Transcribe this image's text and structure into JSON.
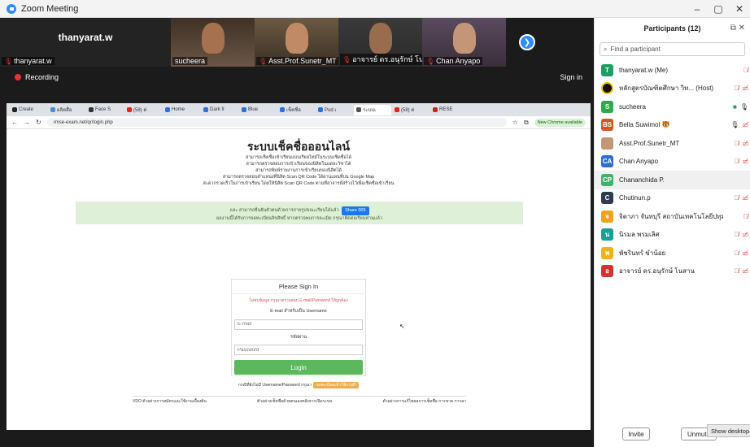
{
  "window": {
    "title": "Zoom Meeting",
    "controls": [
      "–",
      "▢",
      "✕"
    ]
  },
  "gallery": {
    "self_display_name": "thanyarat.w",
    "tiles": [
      {
        "label": "thanyarat.w",
        "muted": true
      },
      {
        "label": "sucheera",
        "muted": false
      },
      {
        "label": "Asst.Prof.Sunetr_MT",
        "muted": true
      },
      {
        "label": "อาจารย์ ดร.อนุรักษ์ โนสาน",
        "muted": true
      },
      {
        "label": "Chan Anyapo",
        "muted": true
      }
    ],
    "next_icon": "chevron-right-icon"
  },
  "status": {
    "recording": "Recording",
    "signin": "Sign in"
  },
  "browser": {
    "tabs": [
      "Create",
      "ผลิตสื่อ",
      "Face S",
      "(58) ต่",
      "Home",
      "Dark II",
      "Blue",
      "เช็คชื่อ",
      "Pod เ",
      "ระบบเ",
      "(58) ต่",
      "RESE"
    ],
    "url": "rmse-exam.net/qr/login.php",
    "new_chrome": "New Chrome available"
  },
  "page": {
    "title": "ระบบเช็คชื่อออนไลน์",
    "intro": [
      "สามารถเช็คชื่อเข้าเรียนแบบเรียลไทม์ในระบบเช็คชื่อได้",
      "สามารถตรวจสอบการเข้าเรียนของนิสิตในแต่ละวิชาได้",
      "สามารถพิมพ์รายงานการเข้าเรียนของนิสิตได้",
      "สามารถตรวจสอบตำแหน่งที่นิสิต Scan QR Code ได้ผ่านแผนที่บน Google Map",
      "สะดวกรวดเร็วในการเข้าเรียน โดยให้นิสิต Scan QR Code ตามที่อาจารย์สร้างไว้เพื่อเช็คชื่อเข้าเรียน"
    ],
    "notice_line1": "และ สามารถยืนยันตัวตนด้วยการถ่ายรูปขณะเรียนได้แล้ว",
    "notice_line2": "ผลงานนี้ได้รับการจดทะเบียนลิขสิทธิ์ หากตรวจพบการละเมิด กรุณาติดต่อเรียนท่านแล้ว",
    "share_label": "Share 005",
    "login": {
      "heading": "Please Sign In",
      "warning": "ไม่พบข้อมูล กรุณาตรวจสอบ E-mail/Password ให้ถูกต้อง",
      "email_label": "E-mail สำหรับเป็น Username",
      "email_placeholder": "E-mail",
      "password_label": "รหัสผ่าน",
      "password_placeholder": "Password",
      "button": "Login"
    },
    "forgot_text": "กรณีที่ยังไม่มี Username/Password กรุณา",
    "forgot_button": "ลงทะเบียนเข้าใช้งานที่",
    "footer_links": [
      "VDO ตัวอย่างการสมัครและใช้งานเบื้องต้น",
      "ตัวอย่างเช็คชื่อด้วยตนเองหลังจากเปิดระบบ",
      "ตัวอย่างการแก้ไขผลการเช็คชื่อ การขาด การลา"
    ]
  },
  "participants": {
    "header": "Participants (12)",
    "search_placeholder": "Find a participant",
    "list": [
      {
        "initial": "T",
        "color": "#1f9e63",
        "name": "thanyarat.w (Me)",
        "mic": "off",
        "cam": "none"
      },
      {
        "initial": "",
        "color": "#111111",
        "name": "หลักสูตรบัณฑิตศึกษา วิท... (Host)",
        "mic": "off",
        "cam": "off"
      },
      {
        "initial": "S",
        "color": "#2fa84f",
        "name": "sucheera",
        "mic": "on",
        "cam": "on"
      },
      {
        "initial": "BS",
        "color": "#d9541e",
        "name": "Bella Suwimol 🐯",
        "mic": "on",
        "cam": "off"
      },
      {
        "initial": "",
        "color": "#8a6a55",
        "name": "Asst.Prof.Sunetr_MT",
        "mic": "off",
        "cam": "off"
      },
      {
        "initial": "CA",
        "color": "#2d6fd8",
        "name": "Chan Anyapo",
        "mic": "off",
        "cam": "off"
      },
      {
        "initial": "CP",
        "color": "#3fb36b",
        "name": "Chananchida P.",
        "mic": "none",
        "cam": "none"
      },
      {
        "initial": "C",
        "color": "#2f3a4b",
        "name": "Chutinun.p",
        "mic": "off",
        "cam": "off"
      },
      {
        "initial": "จ",
        "color": "#f0a21c",
        "name": "จิตาภา จันทบุรี สถาบันเทคโนโลยีปทุมวัน",
        "mic": "off",
        "cam": "none"
      },
      {
        "initial": "น",
        "color": "#16a196",
        "name": "นิรมล พรมเลิศ",
        "mic": "off",
        "cam": "off"
      },
      {
        "initial": "พ",
        "color": "#f2b21b",
        "name": "พัชรินทร์ ขำน้อย",
        "mic": "off",
        "cam": "off"
      },
      {
        "initial": "อ",
        "color": "#d0342c",
        "name": "อาจารย์ ดร.อนุรักษ์ โนสาน",
        "mic": "off",
        "cam": "off"
      }
    ],
    "invite": "Invite",
    "unmute": "Unmute",
    "tooltip": "Show desktop"
  }
}
